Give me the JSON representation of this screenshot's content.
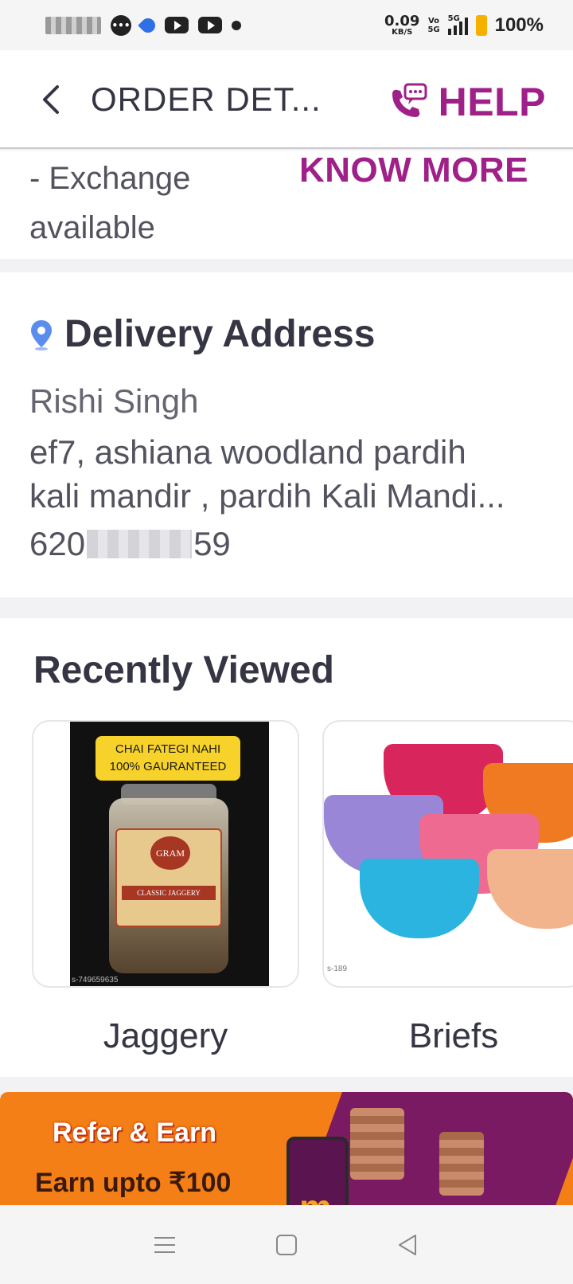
{
  "status_bar": {
    "speed_value": "0.09",
    "speed_unit": "KB/S",
    "volte": "Vo\n5G",
    "network": "5G",
    "battery": "100%"
  },
  "header": {
    "title": "ORDER DET...",
    "help_label": "HELP"
  },
  "exchange": {
    "text": "- Exchange available",
    "know_more": "KNOW MORE"
  },
  "delivery": {
    "title": "Delivery Address",
    "name": "Rishi Singh",
    "line1": "ef7, ashiana woodland pardih",
    "line2": "kali mandir , pardih Kali Mandi...",
    "phone_prefix": "620",
    "phone_suffix": "59"
  },
  "recently_viewed": {
    "title": "Recently Viewed",
    "products": [
      {
        "name": "Jaggery",
        "badge_line1": "CHAI FATEGI NAHI",
        "badge_line2": "100% GAURANTEED",
        "label_brand": "GRAM",
        "label_band": "CLASSIC JAGGERY",
        "sku": "s-749659635"
      },
      {
        "name": "Briefs",
        "sku": "s-189"
      }
    ]
  },
  "banner": {
    "title": "Refer & Earn",
    "subtitle": "Earn upto ₹100",
    "app_glyph": "m"
  },
  "colors": {
    "brand": "#9f2089",
    "banner_orange": "#f47f16",
    "banner_purple": "#7a1a63"
  }
}
